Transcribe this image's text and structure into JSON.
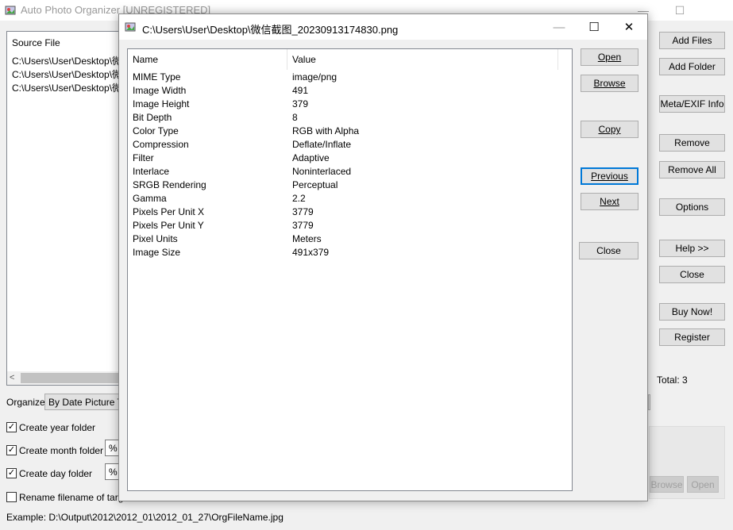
{
  "main_window": {
    "title": "Auto Photo Organizer [UNREGISTERED]",
    "caption_min": "—",
    "caption_max": "☐",
    "source_header": "Source File",
    "source_files": [
      "C:\\Users\\User\\Desktop\\微信",
      "C:\\Users\\User\\Desktop\\微信",
      "C:\\Users\\User\\Desktop\\微信"
    ],
    "organize_label": "Organize",
    "organize_value": "By Date Picture Ta",
    "create_year": "Create year folder",
    "create_month": "Create month folder",
    "create_day": "Create day folder",
    "rename": "Rename filename of targe",
    "month_format": "%",
    "day_format": "%",
    "example": "Example: D:\\Output\\2012\\2012_01\\2012_01_27\\OrgFileName.jpg",
    "total": "Total: 3",
    "buttons": {
      "add_files": "Add Files",
      "add_folder": "Add Folder",
      "meta_info": "Meta/EXIF Info",
      "remove": "Remove",
      "remove_all": "Remove All",
      "options": "Options",
      "help": "Help >>",
      "close": "Close",
      "buy_now": "Buy Now!",
      "register": "Register",
      "browse": "Browse",
      "open": "Open"
    }
  },
  "dialog": {
    "title": "C:\\Users\\User\\Desktop\\微信截图_20230913174830.png",
    "caption_min": "—",
    "caption_max": "☐",
    "caption_close": "✕",
    "columns": [
      "Name",
      "Value"
    ],
    "rows": [
      {
        "name": "MIME Type",
        "value": "image/png"
      },
      {
        "name": "Image Width",
        "value": "491"
      },
      {
        "name": "Image Height",
        "value": "379"
      },
      {
        "name": "Bit Depth",
        "value": "8"
      },
      {
        "name": "Color Type",
        "value": "RGB with Alpha"
      },
      {
        "name": "Compression",
        "value": "Deflate/Inflate"
      },
      {
        "name": "Filter",
        "value": "Adaptive"
      },
      {
        "name": "Interlace",
        "value": "Noninterlaced"
      },
      {
        "name": "SRGB Rendering",
        "value": "Perceptual"
      },
      {
        "name": "Gamma",
        "value": "2.2"
      },
      {
        "name": "Pixels Per Unit X",
        "value": "3779"
      },
      {
        "name": "Pixels Per Unit Y",
        "value": "3779"
      },
      {
        "name": "Pixel Units",
        "value": "Meters"
      },
      {
        "name": "Image Size",
        "value": "491x379"
      }
    ],
    "buttons": {
      "open": "Open",
      "browse": "Browse",
      "copy": "Copy",
      "previous": "Previous",
      "next": "Next",
      "close": "Close"
    }
  }
}
